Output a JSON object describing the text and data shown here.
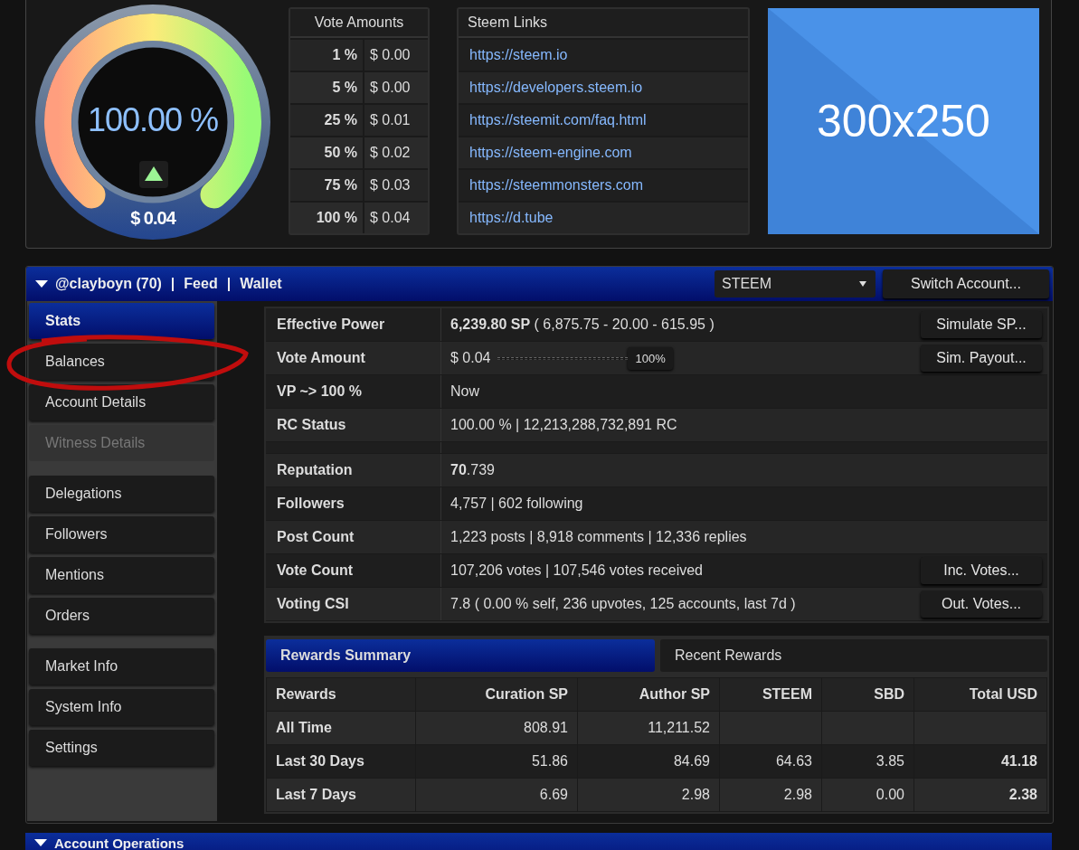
{
  "gauge": {
    "value": "100.00 %",
    "level": 1,
    "payout": "$ 0.04"
  },
  "vote_amounts": {
    "title": "Vote Amounts",
    "rows": [
      {
        "percent": "1 %",
        "amount": "$ 0.00"
      },
      {
        "percent": "5 %",
        "amount": "$ 0.00"
      },
      {
        "percent": "25 %",
        "amount": "$ 0.01"
      },
      {
        "percent": "50 %",
        "amount": "$ 0.02"
      },
      {
        "percent": "75 %",
        "amount": "$ 0.03"
      },
      {
        "percent": "100 %",
        "amount": "$ 0.04"
      }
    ]
  },
  "steem_links": {
    "title": "Steem Links",
    "links": [
      "https://steem.io",
      "https://developers.steem.io",
      "https://steemit.com/faq.html",
      "https://steem-engine.com",
      "https://steemmonsters.com",
      "https://d.tube"
    ]
  },
  "ad": {
    "label": "300x250"
  },
  "account_bar": {
    "expanded": true,
    "username": "@clayboyn (70)",
    "separators": [
      "|",
      "|"
    ],
    "links": [
      "Feed",
      "Wallet"
    ],
    "currency_select": {
      "value": "STEEM"
    },
    "switch_button": "Switch Account..."
  },
  "sidebar": {
    "groups": [
      {
        "items": [
          {
            "label": "Stats",
            "selected": true,
            "disabled": false
          },
          {
            "label": "Balances",
            "selected": false,
            "disabled": false
          },
          {
            "label": "Account Details",
            "selected": false,
            "disabled": false
          },
          {
            "label": "Witness Details",
            "selected": false,
            "disabled": true
          }
        ]
      },
      {
        "items": [
          {
            "label": "Delegations",
            "selected": false,
            "disabled": false
          },
          {
            "label": "Followers",
            "selected": false,
            "disabled": false
          },
          {
            "label": "Mentions",
            "selected": false,
            "disabled": false
          },
          {
            "label": "Orders",
            "selected": false,
            "disabled": false
          }
        ]
      },
      {
        "items": [
          {
            "label": "Market Info",
            "selected": false,
            "disabled": false
          },
          {
            "label": "System Info",
            "selected": false,
            "disabled": false
          },
          {
            "label": "Settings",
            "selected": false,
            "disabled": false
          }
        ]
      }
    ]
  },
  "stats": {
    "rows": [
      {
        "kind": "row",
        "label": "Effective Power",
        "value": "**6,239.80 SP** ( 6,875.75 - 20.00 - 615.95 )",
        "button": "Simulate SP..."
      },
      {
        "kind": "slider",
        "label": "Vote Amount",
        "value": "$ 0.04",
        "level": 1,
        "reading": "100%",
        "button": "Sim. Payout..."
      },
      {
        "kind": "row",
        "label": "VP ~> 100 %",
        "value": "Now"
      },
      {
        "kind": "row",
        "label": "RC Status",
        "value": "100.00 %  |  12,213,288,732,891 RC"
      },
      {
        "kind": "spacer"
      },
      {
        "kind": "row",
        "label": "Reputation",
        "value": "**70**.739"
      },
      {
        "kind": "row",
        "label": "Followers",
        "value": "4,757  |  602 following"
      },
      {
        "kind": "row",
        "label": "Post Count",
        "value": "1,223 posts  |  8,918 comments  |  12,336 replies"
      },
      {
        "kind": "row",
        "label": "Vote Count",
        "value": "107,206 votes  |  107,546 votes received",
        "button": "Inc. Votes..."
      },
      {
        "kind": "row",
        "label": "Voting CSI",
        "value": "7.8 ( 0.00 % self, 236 upvotes, 125 accounts, last 7d )",
        "button": "Out. Votes..."
      }
    ]
  },
  "rewards": {
    "tabs": [
      {
        "label": "Rewards Summary",
        "selected": true
      },
      {
        "label": "Recent Rewards",
        "selected": false
      }
    ],
    "columns": [
      "Rewards",
      "Curation SP",
      "Author SP",
      "STEEM",
      "SBD",
      "Total USD"
    ],
    "rows": [
      [
        "All Time",
        "808.91",
        "11,211.52",
        "",
        "",
        ""
      ],
      [
        "Last 30 Days",
        "51.86",
        "84.69",
        "64.63",
        "3.85",
        "41.18"
      ],
      [
        "Last 7 Days",
        "6.69",
        "2.98",
        "2.98",
        "0.00",
        "2.38"
      ]
    ]
  },
  "operations_bar": {
    "title": "Account Operations"
  }
}
